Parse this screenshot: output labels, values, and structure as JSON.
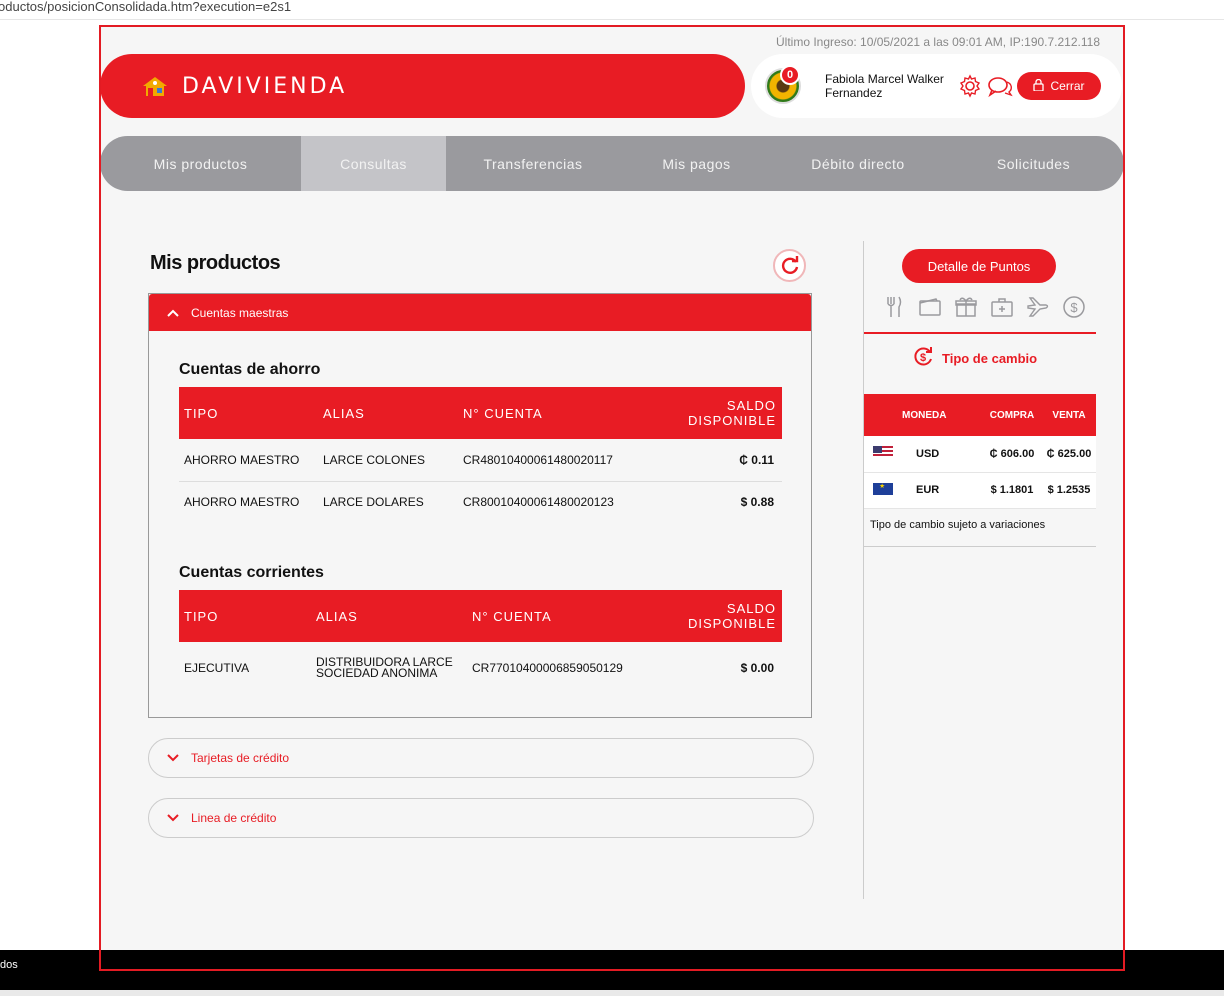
{
  "browser": {
    "url": "oductos/posicionConsolidada.htm?execution=e2s1"
  },
  "header": {
    "last_login": "Último Ingreso: 10/05/2021 a las 09:01 AM, IP:190.7.212.118",
    "brand": "DAVIVIENDA",
    "notifications_count": "0",
    "user_name": "Fabiola Marcel Walker Fernandez",
    "logout_label": "Cerrar"
  },
  "nav": {
    "items": [
      "Mis productos",
      "Consultas",
      "Transferencias",
      "Mis pagos",
      "Débito directo",
      "Solicitudes"
    ],
    "active_index": 1
  },
  "main": {
    "title": "Mis productos",
    "accordion_open_label": "Cuentas maestras",
    "savings": {
      "title": "Cuentas de ahorro",
      "headers": [
        "TIPO",
        "ALIAS",
        "N° CUENTA",
        "SALDO DISPONIBLE"
      ],
      "rows": [
        {
          "tipo": "AHORRO MAESTRO",
          "alias": "LARCE COLONES",
          "cuenta": "CR48010400061480020117",
          "saldo": "₵ 0.11"
        },
        {
          "tipo": "AHORRO MAESTRO",
          "alias": "LARCE DOLARES",
          "cuenta": "CR80010400061480020123",
          "saldo": "$ 0.88"
        }
      ]
    },
    "current": {
      "title": "Cuentas corrientes",
      "headers": [
        "TIPO",
        "ALIAS",
        "N° CUENTA",
        "SALDO DISPONIBLE"
      ],
      "rows": [
        {
          "tipo": "EJECUTIVA",
          "alias_line1": "DISTRIBUIDORA LARCE",
          "alias_line2": "SOCIEDAD ANONIMA",
          "cuenta": "CR77010400006859050129",
          "saldo": "$ 0.00"
        }
      ]
    },
    "credit_cards_label": "Tarjetas de crédito",
    "credit_line_label": "Linea de crédito"
  },
  "sidebar": {
    "points_button": "Detalle de Puntos",
    "point_icons": [
      "restaurant-icon",
      "wallet-icon",
      "gift-icon",
      "health-icon",
      "plane-icon",
      "dollar-icon"
    ],
    "exchange_title": "Tipo de cambio",
    "fx_headers": [
      "MONEDA",
      "COMPRA",
      "VENTA"
    ],
    "fx_rows": [
      {
        "currency": "USD",
        "buy": "₵ 606.00",
        "sell": "₵ 625.00"
      },
      {
        "currency": "EUR",
        "buy": "$ 1.1801",
        "sell": "$ 1.2535"
      }
    ],
    "fx_note": "Tipo de cambio sujeto a variaciones"
  },
  "taskbar": {
    "text": "dos"
  },
  "colors": {
    "brand_red": "#e81c24",
    "nav_gray": "#9a9a9e",
    "nav_active": "#c4c4c8"
  }
}
